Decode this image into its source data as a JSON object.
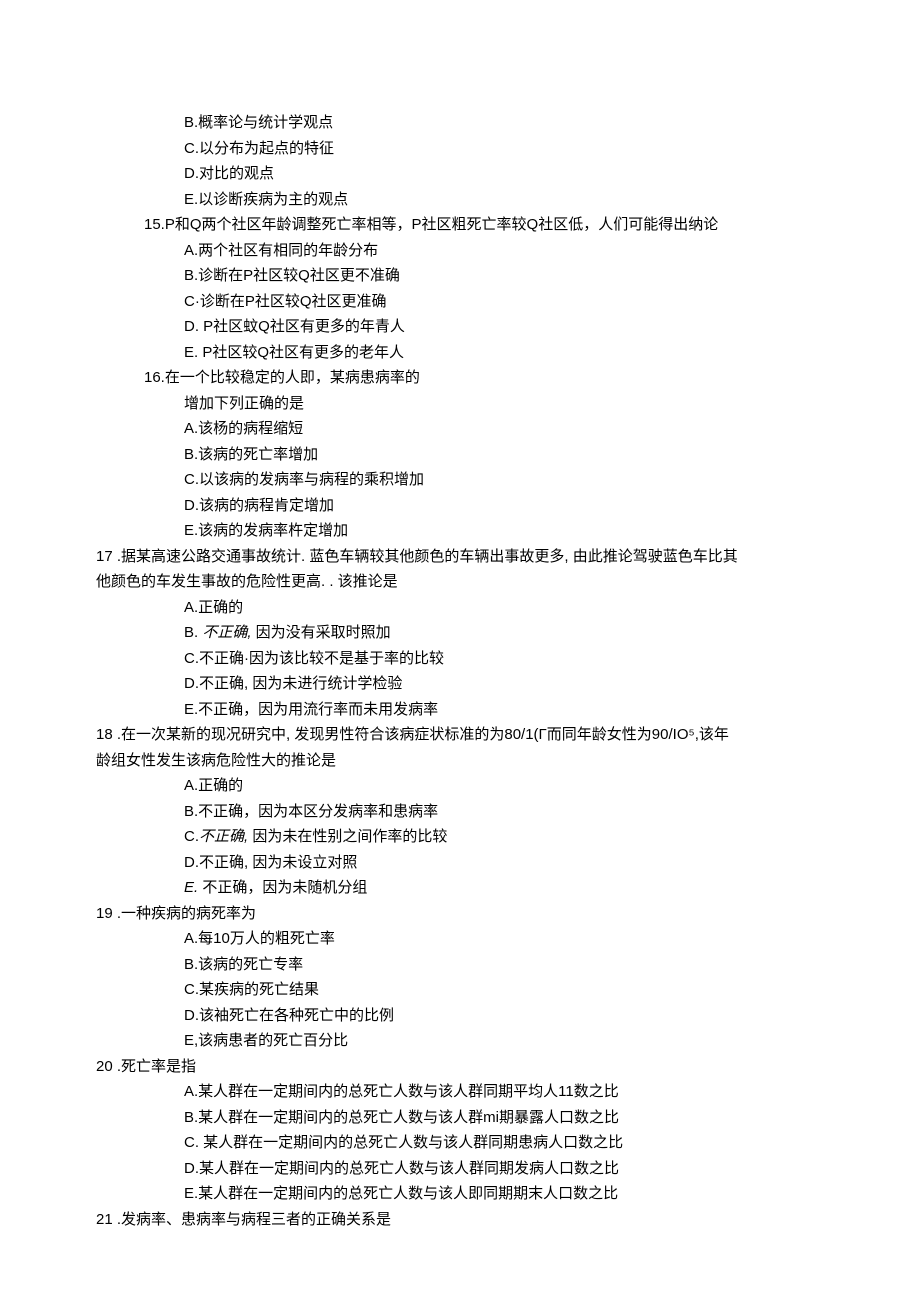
{
  "opts_pre": [
    "B.概率论与统计学观点",
    "C.以分布为起点的特征",
    "D.对比的观点",
    "E.以诊断疾病为主的观点"
  ],
  "q15": {
    "stem": "15.P和Q两个社区年龄调整死亡率相等，P社区粗死亡率较Q社区低，人们可能得出纳论",
    "opts": [
      "A.两个社区有相同的年龄分布",
      "B.诊断在P社区较Q社区更不准确",
      "C·诊断在P社区较Q社区更准确",
      "D.   P社区蚊Q社区有更多的年青人",
      "E.   P社区较Q社区有更多的老年人"
    ]
  },
  "q16": {
    "stem1": "16.在一个比较稳定的人即，某病患病率的",
    "stem2": "增加下列正确的是",
    "opts": [
      "A.该杨的病程缩短",
      "B.该病的死亡率增加",
      "C.以该病的发病率与病程的乘积增加",
      "D.该病的病程肯定增加",
      "E.该病的发病率杵定增加"
    ]
  },
  "q17": {
    "stem1": "17  .据某高速公路交通事故统计. 蓝色车辆较其他颜色的车辆出事故更多, 由此推论驾驶蓝色车比其",
    "stem2": "他颜色的车发生事故的危险性更高. . 该推论是",
    "opts": [
      {
        "t": "A.正确的"
      },
      {
        "t": "B. 不正确, 因为没有采取时照加",
        "italic_word": "不正确,"
      },
      {
        "t": "C.不正确·因为该比较不是基于率的比较"
      },
      {
        "t": "D.不正确, 因为未进行统计学检验"
      },
      {
        "t": "E.不正确，因为用流行率而未用发病率"
      }
    ]
  },
  "q18": {
    "stem1": "18  .在一次某新的现况研究中, 发现男性符合该病症状标准的为80/1(Γ而同年龄女性为90/IO⁵,该年",
    "stem2": "龄组女性发生该病危险性大的推论是",
    "opts": [
      {
        "t": "A.正确的"
      },
      {
        "t": "B.不正确，因为本区分发病率和患病率"
      },
      {
        "pre": "C.",
        "italic": "不正确,",
        "post": " 因为未在性别之间作率的比较"
      },
      {
        "t": "D.不正确, 因为未设立对照"
      },
      {
        "pre_italic": "E.",
        "post": " 不正确，因为未随机分组"
      }
    ]
  },
  "q19": {
    "stem": "19  .一种疾病的病死率为",
    "opts": [
      "A.每10万人的粗死亡率",
      "B.该病的死亡专率",
      "C.某疾病的死亡结果",
      "D.该袖死亡在各种死亡中的比例",
      "E,该病患者的死亡百分比"
    ]
  },
  "q20": {
    "stem": "20  .死亡率是指",
    "opts": [
      "A.某人群在一定期间内的总死亡人数与该人群同期平均人11数之比",
      "B.某人群在一定期间内的总死亡人数与该人群mi期暴露人口数之比",
      "C. 某人群在一定期间内的总死亡人数与该人群同期患病人口数之比",
      "D.某人群在一定期间内的总死亡人数与该人群同期发病人口数之比",
      "E.某人群在一定期间内的总死亡人数与该人即同期期末人口数之比"
    ]
  },
  "q21": {
    "stem": "21  .发病率、患病率与病程三者的正确关系是"
  }
}
